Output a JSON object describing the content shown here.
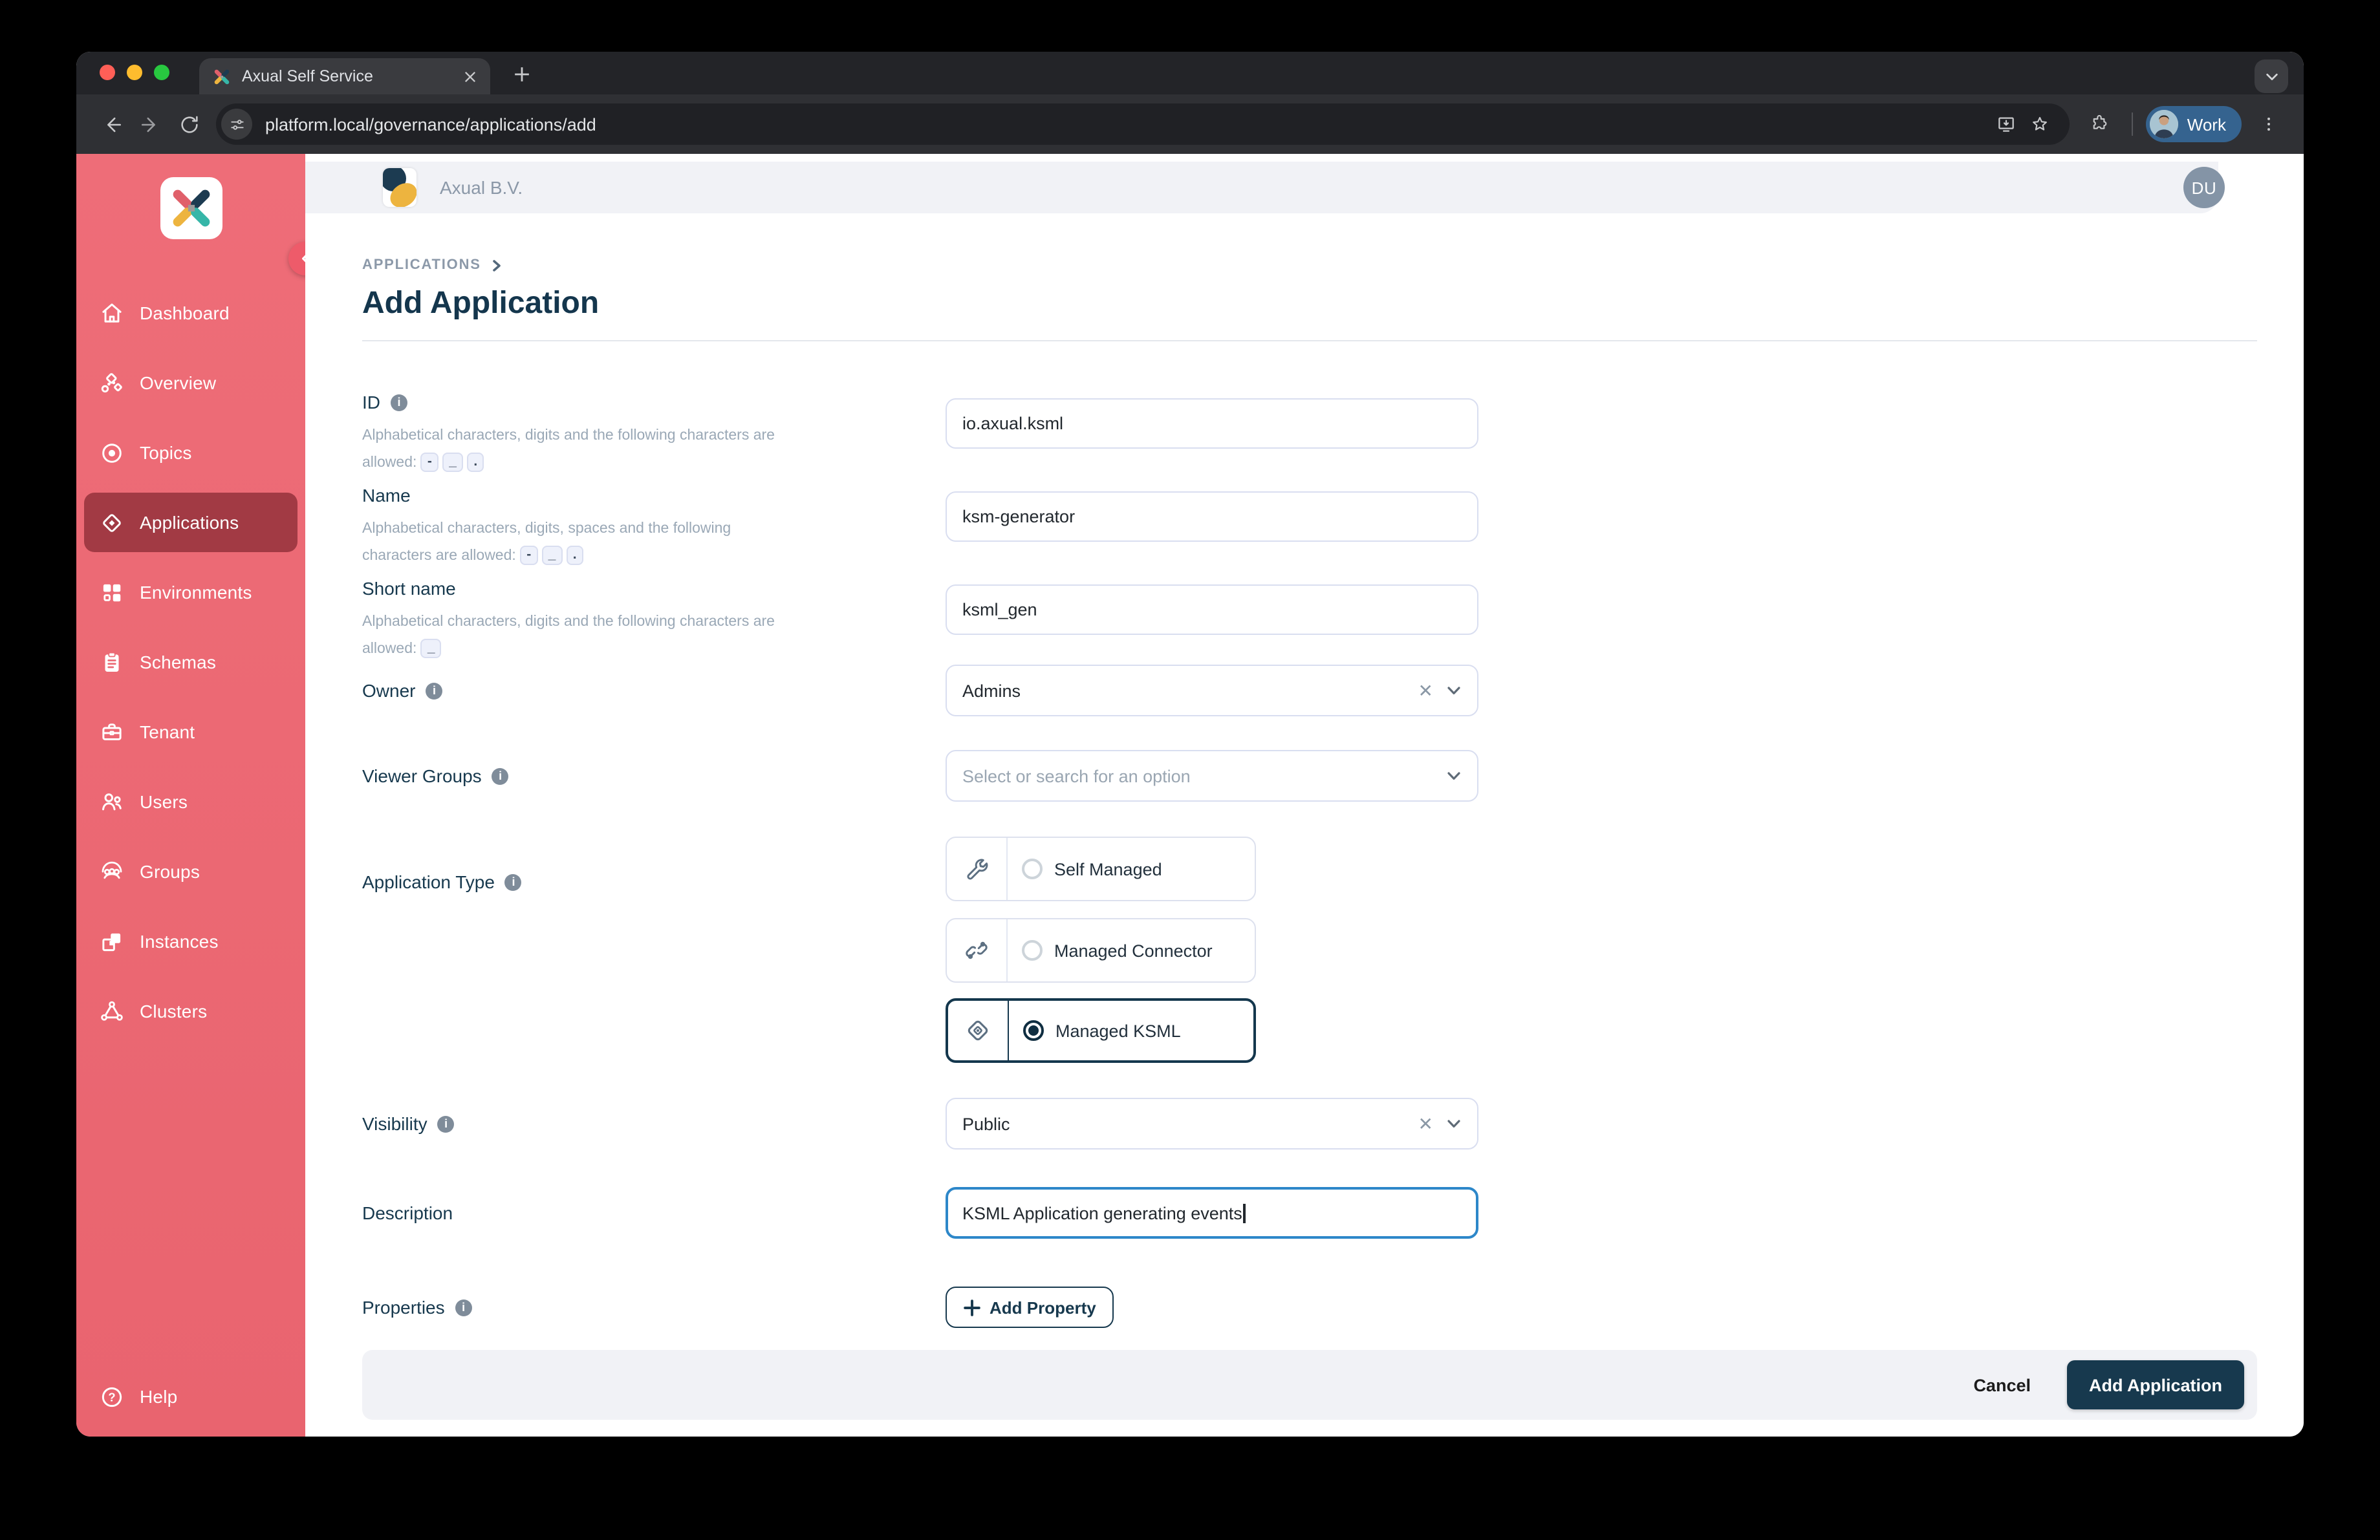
{
  "browser": {
    "tab_title": "Axual Self Service",
    "url": "platform.local/governance/applications/add",
    "profile_label": "Work"
  },
  "appbar": {
    "tenant": "Axual B.V.",
    "avatar_initials": "DU"
  },
  "sidebar": {
    "items": [
      {
        "label": "Dashboard"
      },
      {
        "label": "Overview"
      },
      {
        "label": "Topics"
      },
      {
        "label": "Applications"
      },
      {
        "label": "Environments"
      },
      {
        "label": "Schemas"
      },
      {
        "label": "Tenant"
      },
      {
        "label": "Users"
      },
      {
        "label": "Groups"
      },
      {
        "label": "Instances"
      },
      {
        "label": "Clusters"
      }
    ],
    "active_item": "Applications",
    "help_label": "Help"
  },
  "page": {
    "breadcrumb": "APPLICATIONS",
    "title": "Add Application"
  },
  "form": {
    "id": {
      "label": "ID",
      "hint": "Alphabetical characters, digits and the following characters are allowed:",
      "allowed": [
        "-",
        "_",
        "."
      ],
      "value": "io.axual.ksml"
    },
    "name": {
      "label": "Name",
      "hint": "Alphabetical characters, digits, spaces and the following characters are allowed:",
      "allowed": [
        "-",
        "_",
        "."
      ],
      "value": "ksm-generator"
    },
    "short_name": {
      "label": "Short name",
      "hint": "Alphabetical characters, digits and the following characters are allowed:",
      "allowed": [
        "_"
      ],
      "value": "ksml_gen"
    },
    "owner": {
      "label": "Owner",
      "value": "Admins"
    },
    "viewer_groups": {
      "label": "Viewer Groups",
      "placeholder": "Select or search for an option"
    },
    "application_type": {
      "label": "Application Type",
      "options": [
        {
          "label": "Self Managed",
          "selected": false
        },
        {
          "label": "Managed Connector",
          "selected": false
        },
        {
          "label": "Managed KSML",
          "selected": true
        }
      ]
    },
    "visibility": {
      "label": "Visibility",
      "value": "Public"
    },
    "description": {
      "label": "Description",
      "value": "KSML Application generating events"
    },
    "properties": {
      "label": "Properties",
      "button_label": "Add Property"
    }
  },
  "footer": {
    "cancel_label": "Cancel",
    "submit_label": "Add Application"
  },
  "colors": {
    "sidebar": "#ec6a75",
    "sidebar_active": "#a23a44",
    "navy": "#17394e",
    "focus_blue": "#2d87c9",
    "header_bar": "#f1f2f6"
  }
}
